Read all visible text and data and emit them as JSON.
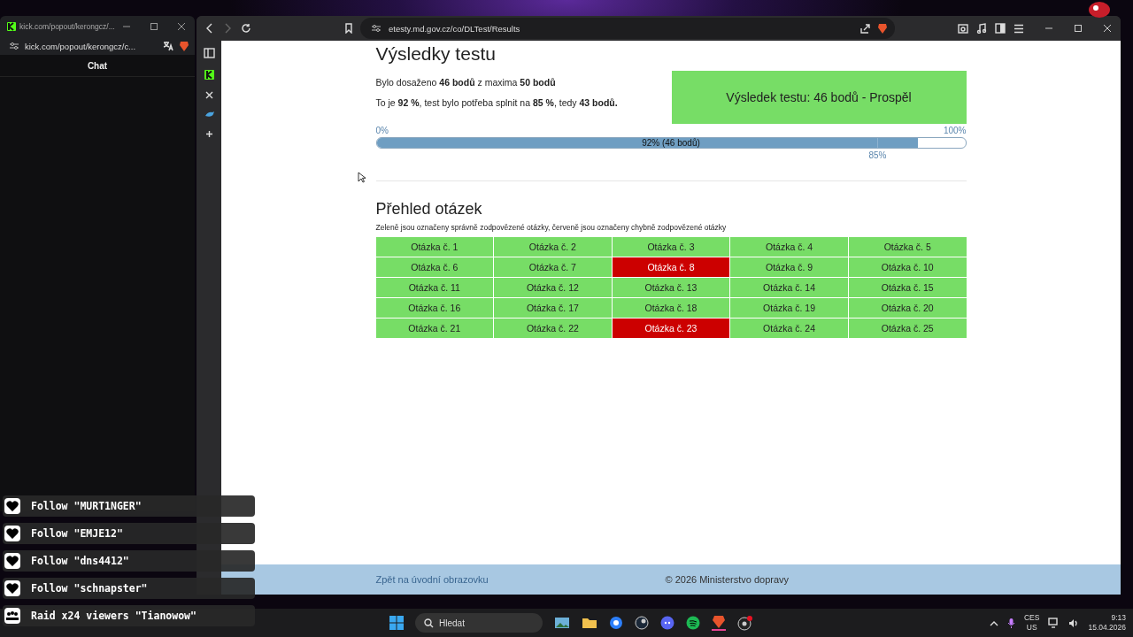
{
  "chat_window": {
    "tab_title": "kick.com/popout/kerongcz/...",
    "url": "kick.com/popout/kerongcz/c...",
    "header": "Chat"
  },
  "browser": {
    "url": "etesty.md.gov.cz/co/DLTest/Results"
  },
  "page": {
    "title": "Výsledky testu",
    "summary": [
      "Bylo dosaženo **46 bodů** z maxima **50 bodů**",
      "To je **92 %**, test bylo potřeba splnit na **85 %**, tedy **43 bodů.**"
    ],
    "result": {
      "text": "Výsledek testu: 46 bodů - Prospěl",
      "passed": true
    },
    "progress": {
      "min_label": "0%",
      "max_label": "100%",
      "label": "92% (46 bodů)",
      "level": 0.92,
      "threshold": {
        "label": "85%",
        "level": 0.85
      }
    },
    "overview": {
      "title": "Přehled otázek",
      "note": "Zeleně jsou označeny správně zodpovězené otázky, červeně jsou označeny chybně zodpovězené otázky",
      "questions": [
        {
          "label": "Otázka č. 1",
          "correct": true
        },
        {
          "label": "Otázka č. 2",
          "correct": true
        },
        {
          "label": "Otázka č. 3",
          "correct": true
        },
        {
          "label": "Otázka č. 4",
          "correct": true
        },
        {
          "label": "Otázka č. 5",
          "correct": true
        },
        {
          "label": "Otázka č. 6",
          "correct": true
        },
        {
          "label": "Otázka č. 7",
          "correct": true
        },
        {
          "label": "Otázka č. 8",
          "correct": false
        },
        {
          "label": "Otázka č. 9",
          "correct": true
        },
        {
          "label": "Otázka č. 10",
          "correct": true
        },
        {
          "label": "Otázka č. 11",
          "correct": true
        },
        {
          "label": "Otázka č. 12",
          "correct": true
        },
        {
          "label": "Otázka č. 13",
          "correct": true
        },
        {
          "label": "Otázka č. 14",
          "correct": true
        },
        {
          "label": "Otázka č. 15",
          "correct": true
        },
        {
          "label": "Otázka č. 16",
          "correct": true
        },
        {
          "label": "Otázka č. 17",
          "correct": true
        },
        {
          "label": "Otázka č. 18",
          "correct": true
        },
        {
          "label": "Otázka č. 19",
          "correct": true
        },
        {
          "label": "Otázka č. 20",
          "correct": true
        },
        {
          "label": "Otázka č. 21",
          "correct": true
        },
        {
          "label": "Otázka č. 22",
          "correct": true
        },
        {
          "label": "Otázka č. 23",
          "correct": false
        },
        {
          "label": "Otázka č. 24",
          "correct": true
        },
        {
          "label": "Otázka č. 25",
          "correct": true
        }
      ]
    },
    "footer": {
      "link": "Zpět na úvodní obrazovku",
      "copyright": "© 2026 Ministerstvo dopravy"
    }
  },
  "alerts": [
    {
      "kind": "follow",
      "text": "Follow \"MURT1NGER\""
    },
    {
      "kind": "follow",
      "text": "Follow \"EMJE12\""
    },
    {
      "kind": "follow",
      "text": "Follow \"dns4412\""
    },
    {
      "kind": "follow",
      "text": "Follow \"schnapster\""
    },
    {
      "kind": "raid",
      "text": "Raid x24 viewers \"Tianowow\""
    }
  ],
  "taskbar": {
    "search_placeholder": "Hledat",
    "language": "CES",
    "layout": "US",
    "time": "9:13",
    "date": "15.04.2026"
  }
}
